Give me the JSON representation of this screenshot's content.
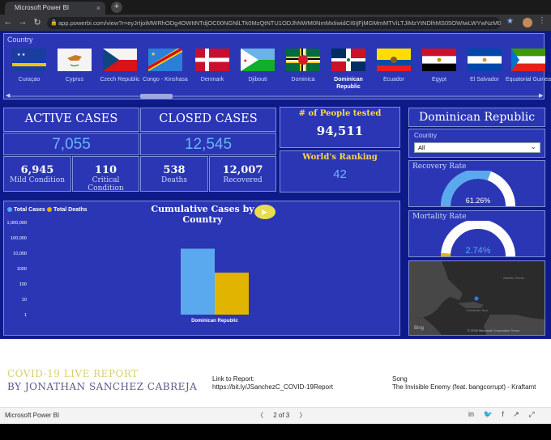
{
  "browser": {
    "tab_title": "Microsoft Power BI",
    "tab_close": "×",
    "new_tab": "+",
    "back": "←",
    "forward": "→",
    "reload": "↻",
    "url": "app.powerbi.com/view?r=eyJrIjoiMWRhODg4OWItNTdjOC00NGNlLTk0MzQtNTU1ODJhNWM0NmMxIiwidCI6IjFjMGMmMTViLTJiMzYtNDlhMS05OWIwLWYwNzM0Y2UzMTc1MCJ9",
    "lock_icon": "lock-icon",
    "star": "★",
    "menu": "⋮"
  },
  "slicer": {
    "title": "Country",
    "countries": [
      "Curaçao",
      "Cyprus",
      "Czech Republic",
      "Congo - Kinshasa",
      "Denmark",
      "Djibouti",
      "Dominica",
      "Dominican Republic",
      "Ecuador",
      "Egypt",
      "El Salvador",
      "Equatorial Guinea"
    ],
    "selected": "Dominican Republic",
    "left_arrow": "◀",
    "right_arrow": "▶"
  },
  "kpis": {
    "active_title": "ACTIVE CASES",
    "active_value": "7,055",
    "closed_title": "CLOSED CASES",
    "closed_value": "12,545",
    "mild_value": "6,945",
    "mild_label": "Mild Condition",
    "critical_value": "110",
    "critical_label": "Critical Condition",
    "deaths_value": "538",
    "deaths_label": "Deaths",
    "recovered_value": "12,007",
    "recovered_label": "Recovered",
    "tested_title": "# of People tested",
    "tested_value": "94,511",
    "ranking_title": "World's Ranking",
    "ranking_value": "42"
  },
  "right_panel": {
    "country_name": "Dominican Republic",
    "dropdown_label": "Country",
    "dropdown_value": "All",
    "recovery_title": "Recovery Rate",
    "recovery_value": "61.26%",
    "recovery_fraction": 0.6126,
    "mortality_title": "Mortality Rate",
    "mortality_value": "2.74%",
    "mortality_fraction": 0.0274,
    "map_logo": "Bing",
    "map_copyright": "© 2020 Microsoft Corporation  Terms",
    "map_label_1": "Atlantic Ocean",
    "map_label_2": "Caribbean Sea"
  },
  "chart_data": {
    "type": "bar",
    "title": "Cumulative Cases by Country",
    "categories": [
      "Dominican Republic"
    ],
    "series": [
      {
        "name": "Total Cases",
        "values": [
          19600
        ],
        "color": "#5aa9ee"
      },
      {
        "name": "Total Deaths",
        "values": [
          538
        ],
        "color": "#e0b400"
      }
    ],
    "yscale": "log",
    "ytick_labels": [
      "1,000,000",
      "100,000",
      "10,000",
      "1000",
      "100",
      "10",
      "1"
    ],
    "ylim": [
      1,
      1000000
    ],
    "legend_position": "top-left"
  },
  "footer": {
    "report_title": "COVID-19 LIVE REPORT",
    "author": "BY JONATHAN SANCHEZ CABREJA",
    "link_label": "Link to Report:",
    "link_url": "https://bit.ly/JSanchezC_COVID-19Report",
    "song_label": "Song",
    "song_name": "The Invisible Enemy (feat. bangcorrupt) - Kraftamt"
  },
  "statusbar": {
    "app_name": "Microsoft Power BI",
    "prev": "〈",
    "page": "2 of 3",
    "next": "〉",
    "icons": [
      "linkedin-icon",
      "twitter-icon",
      "facebook-icon",
      "share-icon",
      "fullscreen-icon"
    ]
  }
}
